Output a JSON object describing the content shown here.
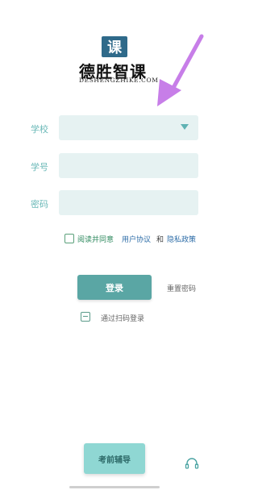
{
  "logo": {
    "icon_text": "课",
    "title": "德胜智课",
    "domain": "DESHENGZHIKE.COM"
  },
  "form": {
    "school_label": "学校",
    "student_id_label": "学号",
    "password_label": "密码",
    "school_value": "",
    "student_id_value": "",
    "password_value": ""
  },
  "agreement": {
    "prefix": "阅读并同意",
    "user_agreement": "用户协议",
    "and": "和",
    "privacy_policy": "隐私政策",
    "checked": false
  },
  "actions": {
    "login": "登录",
    "reset_password": "重置密码",
    "scan_login": "通过扫码登录",
    "exam_tutoring": "考前辅导"
  },
  "icons": {
    "dropdown": "chevron-down-icon",
    "scan": "scan-icon",
    "support": "headset-icon",
    "annotation": "arrow-annotation"
  },
  "colors": {
    "accent": "#5aa6a4",
    "field_bg": "#e6f2f2",
    "label": "#6bb9b8",
    "annotation": "#c77ee8"
  }
}
